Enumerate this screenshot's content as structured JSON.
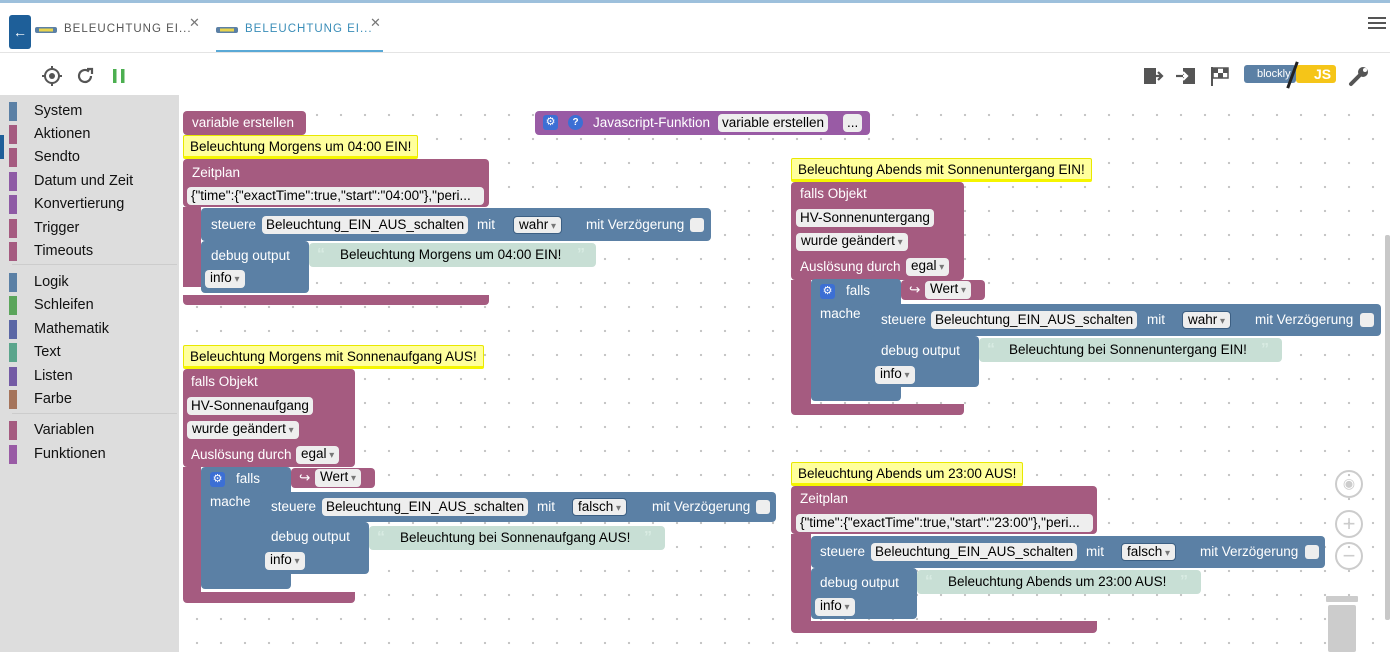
{
  "tabs": [
    {
      "label": "BELEUCHTUNG EI..."
    },
    {
      "label": "BELEUCHTUNG EI..."
    }
  ],
  "toolbar": {
    "blockly_label": "blockly",
    "js_label": "JS"
  },
  "sidebar": {
    "categories": [
      {
        "label": "System",
        "color": "#5b80a5"
      },
      {
        "label": "Aktionen",
        "color": "#a55b80"
      },
      {
        "label": "Sendto",
        "color": "#a55b80"
      },
      {
        "label": "Datum und Zeit",
        "color": "#8e5ba5"
      },
      {
        "label": "Konvertierung",
        "color": "#8e5ba5"
      },
      {
        "label": "Trigger",
        "color": "#a55b80"
      },
      {
        "label": "Timeouts",
        "color": "#a55b80"
      },
      {
        "label": "Logik",
        "color": "#5b80a5"
      },
      {
        "label": "Schleifen",
        "color": "#5ba55b"
      },
      {
        "label": "Mathematik",
        "color": "#5b67a5"
      },
      {
        "label": "Text",
        "color": "#5ba58c"
      },
      {
        "label": "Listen",
        "color": "#745ba5"
      },
      {
        "label": "Farbe",
        "color": "#a5745b"
      },
      {
        "label": "Variablen",
        "color": "#a55b80"
      },
      {
        "label": "Funktionen",
        "color": "#995ba5"
      }
    ]
  },
  "workspace": {
    "var_block": "variable erstellen",
    "js_func": {
      "label": "Javascript-Funktion",
      "var": "variable erstellen",
      "more": "..."
    },
    "b1": {
      "comment": "Beleuchtung Morgens um 04:00 EIN!",
      "head": "Zeitplan",
      "schedule": "{\"time\":{\"exactTime\":true,\"start\":\"04:00\"},\"peri...",
      "control": "steuere",
      "obj": "Beleuchtung_EIN_AUS_schalten",
      "mit": "mit",
      "value": "wahr",
      "delay": "mit Verzögerung",
      "debug": "debug output",
      "text": "Beleuchtung Morgens um 04:00 EIN!",
      "level": "info"
    },
    "b2": {
      "comment": "Beleuchtung Morgens mit Sonnenaufgang AUS!",
      "head": "falls Objekt",
      "obj_id": "HV-Sonnenaufgang",
      "changed": "wurde geändert",
      "trig": "Auslösung durch",
      "trig_val": "egal",
      "if": "falls",
      "cond": "Wert",
      "do": "mache",
      "control": "steuere",
      "obj": "Beleuchtung_EIN_AUS_schalten",
      "mit": "mit",
      "value": "falsch",
      "delay": "mit Verzögerung",
      "debug": "debug output",
      "text": "Beleuchtung bei Sonnenaufgang AUS!",
      "level": "info"
    },
    "b3": {
      "comment": "Beleuchtung Abends mit Sonnenuntergang EIN!",
      "head": "falls Objekt",
      "obj_id": "HV-Sonnenuntergang",
      "changed": "wurde geändert",
      "trig": "Auslösung durch",
      "trig_val": "egal",
      "if": "falls",
      "cond": "Wert",
      "do": "mache",
      "control": "steuere",
      "obj": "Beleuchtung_EIN_AUS_schalten",
      "mit": "mit",
      "value": "wahr",
      "delay": "mit Verzögerung",
      "debug": "debug output",
      "text": "Beleuchtung bei Sonnenuntergang EIN!",
      "level": "info"
    },
    "b4": {
      "comment": "Beleuchtung Abends um 23:00 AUS!",
      "head": "Zeitplan",
      "schedule": "{\"time\":{\"exactTime\":true,\"start\":\"23:00\"},\"peri...",
      "control": "steuere",
      "obj": "Beleuchtung_EIN_AUS_schalten",
      "mit": "mit",
      "value": "falsch",
      "delay": "mit Verzögerung",
      "debug": "debug output",
      "text": "Beleuchtung Abends um 23:00 AUS!",
      "level": "info"
    }
  },
  "colors": {
    "action": "#a55b80",
    "system": "#5b80a5",
    "text": "#c8dfd5",
    "comment": "#ffff9c"
  }
}
